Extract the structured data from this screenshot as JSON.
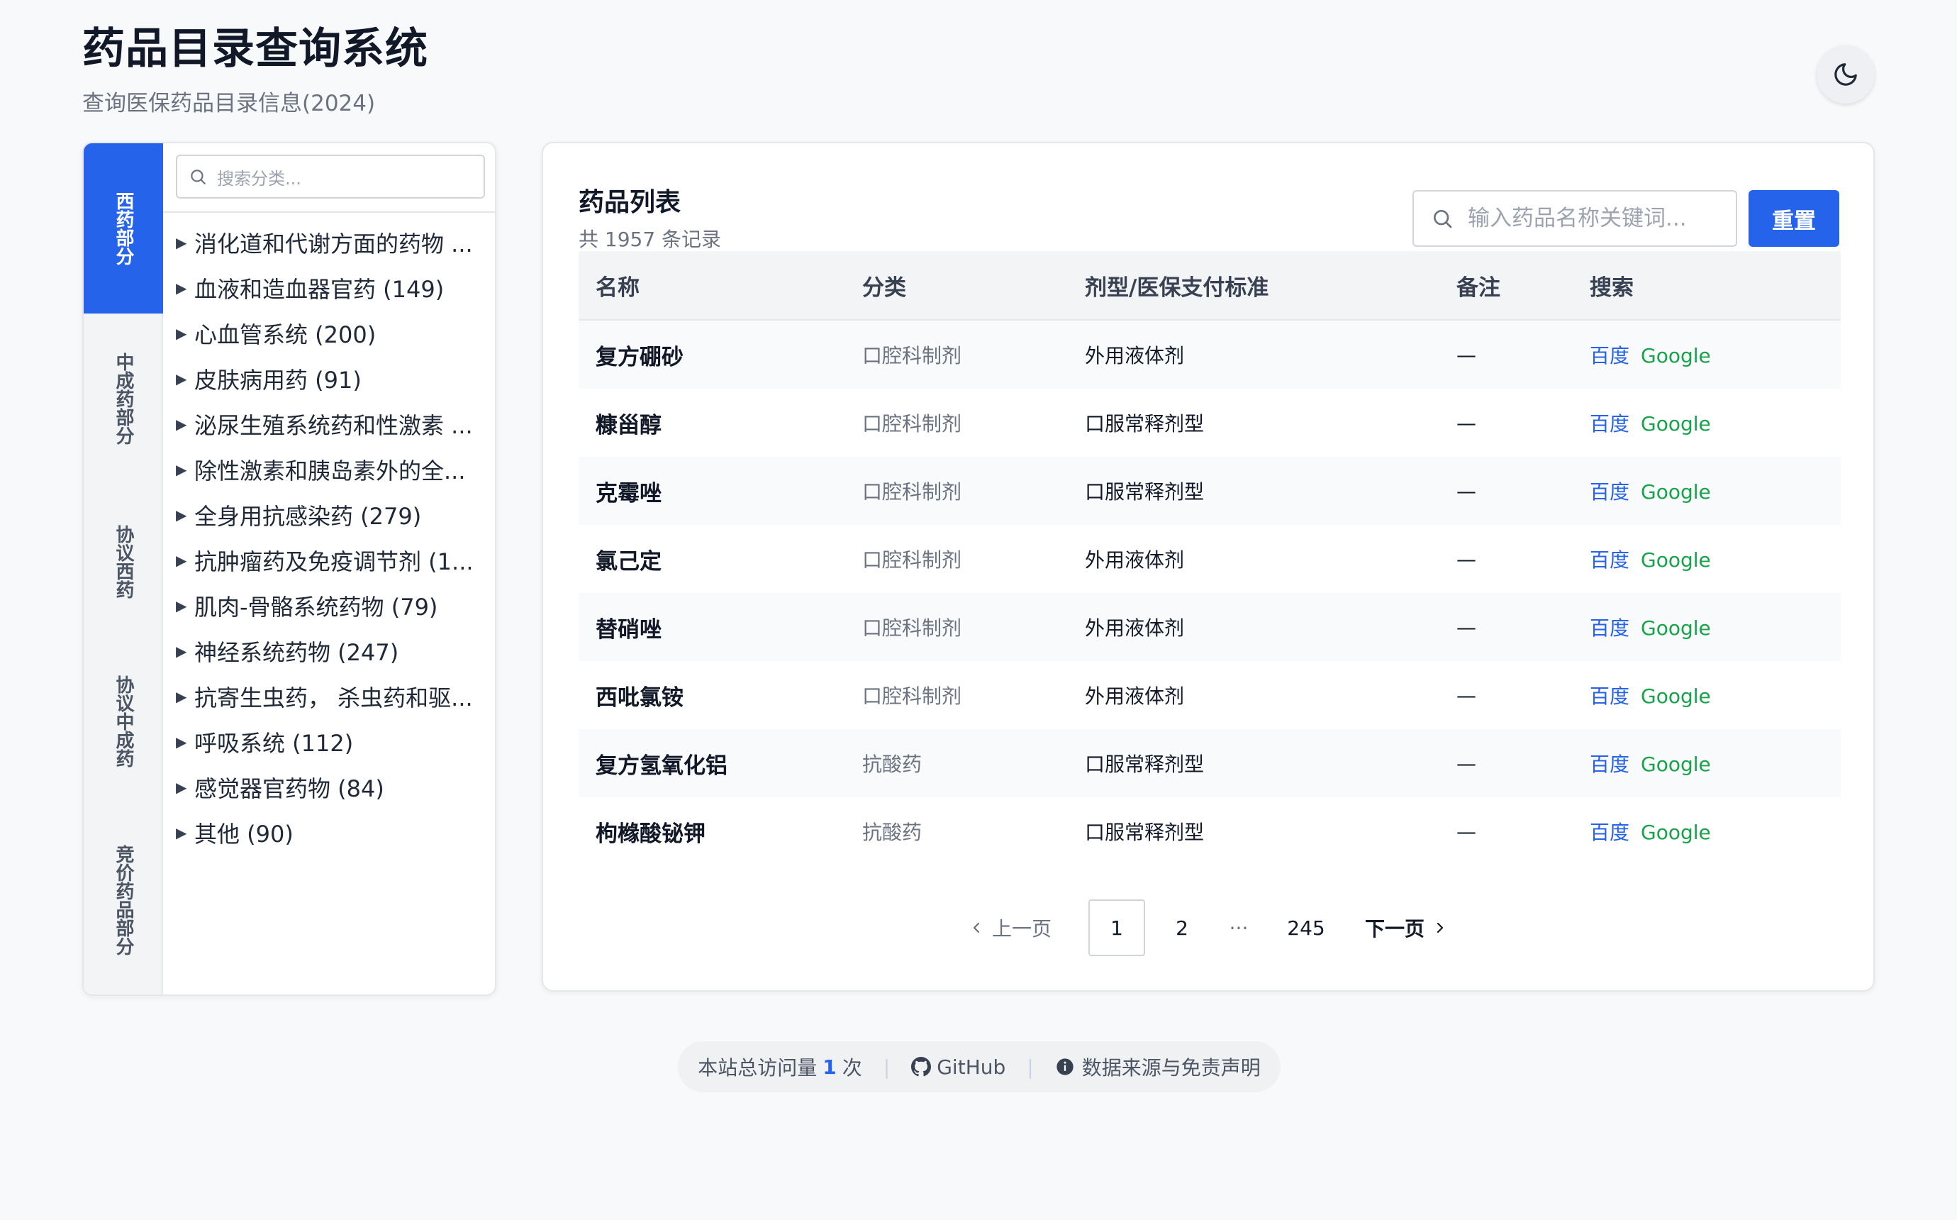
{
  "header": {
    "title": "药品目录查询系统",
    "subtitle": "查询医保药品目录信息(2024)"
  },
  "theme_toggle": {
    "icon": "moon-icon"
  },
  "sidebar": {
    "tabs": [
      {
        "label": "西药部分",
        "active": true
      },
      {
        "label": "中成药部分",
        "active": false
      },
      {
        "label": "协议西药",
        "active": false
      },
      {
        "label": "协议中成药",
        "active": false
      },
      {
        "label": "竞价药品部分",
        "active": false
      }
    ],
    "search_placeholder": "搜索分类...",
    "categories": [
      {
        "label": "消化道和代谢方面的药物 ..."
      },
      {
        "label": "血液和造血器官药 (149)"
      },
      {
        "label": "心血管系统 (200)"
      },
      {
        "label": "皮肤病用药 (91)"
      },
      {
        "label": "泌尿生殖系统药和性激素 ..."
      },
      {
        "label": "除性激素和胰岛素外的全..."
      },
      {
        "label": "全身用抗感染药 (279)"
      },
      {
        "label": "抗肿瘤药及免疫调节剂 (1..."
      },
      {
        "label": "肌肉-骨骼系统药物 (79)"
      },
      {
        "label": "神经系统药物 (247)"
      },
      {
        "label": "抗寄生虫药， 杀虫药和驱..."
      },
      {
        "label": "呼吸系统 (112)"
      },
      {
        "label": "感觉器官药物 (84)"
      },
      {
        "label": "其他 (90)"
      }
    ]
  },
  "main": {
    "title": "药品列表",
    "record_count": "共 1957 条记录",
    "search_placeholder": "输入药品名称关键词...",
    "reset_label": "重置",
    "columns": [
      "名称",
      "分类",
      "剂型/医保支付标准",
      "备注",
      "搜索"
    ],
    "rows": [
      {
        "name": "复方硼砂",
        "category": "口腔科制剂",
        "form": "外用液体剂",
        "note": "—",
        "baidu": "百度",
        "google": "Google"
      },
      {
        "name": "糠甾醇",
        "category": "口腔科制剂",
        "form": "口服常释剂型",
        "note": "—",
        "baidu": "百度",
        "google": "Google"
      },
      {
        "name": "克霉唑",
        "category": "口腔科制剂",
        "form": "口服常释剂型",
        "note": "—",
        "baidu": "百度",
        "google": "Google"
      },
      {
        "name": "氯己定",
        "category": "口腔科制剂",
        "form": "外用液体剂",
        "note": "—",
        "baidu": "百度",
        "google": "Google"
      },
      {
        "name": "替硝唑",
        "category": "口腔科制剂",
        "form": "外用液体剂",
        "note": "—",
        "baidu": "百度",
        "google": "Google"
      },
      {
        "name": "西吡氯铵",
        "category": "口腔科制剂",
        "form": "外用液体剂",
        "note": "—",
        "baidu": "百度",
        "google": "Google"
      },
      {
        "name": "复方氢氧化铝",
        "category": "抗酸药",
        "form": "口服常释剂型",
        "note": "—",
        "baidu": "百度",
        "google": "Google"
      },
      {
        "name": "枸橼酸铋钾",
        "category": "抗酸药",
        "form": "口服常释剂型",
        "note": "—",
        "baidu": "百度",
        "google": "Google"
      }
    ],
    "pagination": {
      "prev": "上一页",
      "current": "1",
      "next_page": "2",
      "ellipsis": "···",
      "last": "245",
      "next": "下一页"
    }
  },
  "footer": {
    "visits_prefix": "本站总访问量",
    "visits_count": "1",
    "visits_suffix": "次",
    "github": "GitHub",
    "disclaimer": "数据来源与免责声明"
  }
}
